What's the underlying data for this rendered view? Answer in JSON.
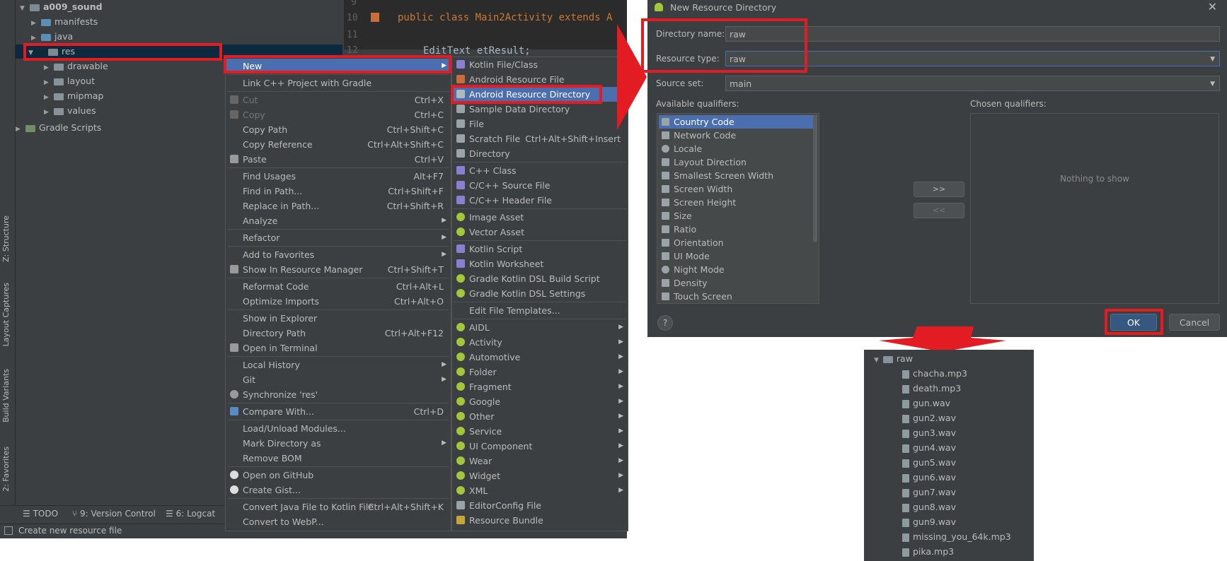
{
  "tree": {
    "project": "a009_sound",
    "items": [
      "manifests",
      "java",
      "res",
      "drawable",
      "layout",
      "mipmap",
      "values",
      "Gradle Scripts"
    ]
  },
  "editor": {
    "lines": [
      {
        "num": "9",
        "code": ""
      },
      {
        "num": "10",
        "code": "public class Main2Activity extends A"
      },
      {
        "num": "11",
        "code": ""
      },
      {
        "num": "12",
        "code": "EditText etResult;"
      }
    ]
  },
  "side_tabs": [
    "Z: Structure",
    "Layout Captures",
    "Build Variants",
    "2: Favorites"
  ],
  "bottom_tabs": [
    "TODO",
    "9: Version Control",
    "6: Logcat"
  ],
  "status_text": "Create new resource file",
  "context_menu": [
    {
      "label": "New",
      "shortcut": "",
      "submenu": true,
      "selected": true
    },
    {
      "label": "Link C++ Project with Gradle",
      "shortcut": ""
    },
    {
      "label": "Cut",
      "shortcut": "Ctrl+X",
      "disabled": true
    },
    {
      "label": "Copy",
      "shortcut": "Ctrl+C",
      "disabled": true
    },
    {
      "label": "Copy Path",
      "shortcut": "Ctrl+Shift+C"
    },
    {
      "label": "Copy Reference",
      "shortcut": "Ctrl+Alt+Shift+C"
    },
    {
      "label": "Paste",
      "shortcut": "Ctrl+V"
    },
    {
      "label": "Find Usages",
      "shortcut": "Alt+F7"
    },
    {
      "label": "Find in Path...",
      "shortcut": "Ctrl+Shift+F"
    },
    {
      "label": "Replace in Path...",
      "shortcut": "Ctrl+Shift+R"
    },
    {
      "label": "Analyze",
      "shortcut": "",
      "submenu": true
    },
    {
      "label": "Refactor",
      "shortcut": "",
      "submenu": true
    },
    {
      "label": "Add to Favorites",
      "shortcut": "",
      "submenu": true
    },
    {
      "label": "Show In Resource Manager",
      "shortcut": "Ctrl+Shift+T"
    },
    {
      "label": "Reformat Code",
      "shortcut": "Ctrl+Alt+L"
    },
    {
      "label": "Optimize Imports",
      "shortcut": "Ctrl+Alt+O"
    },
    {
      "label": "Show in Explorer",
      "shortcut": ""
    },
    {
      "label": "Directory Path",
      "shortcut": "Ctrl+Alt+F12"
    },
    {
      "label": "Open in Terminal",
      "shortcut": ""
    },
    {
      "label": "Local History",
      "shortcut": "",
      "submenu": true
    },
    {
      "label": "Git",
      "shortcut": "",
      "submenu": true
    },
    {
      "label": "Synchronize 'res'",
      "shortcut": ""
    },
    {
      "label": "Compare With...",
      "shortcut": "Ctrl+D"
    },
    {
      "label": "Load/Unload Modules...",
      "shortcut": ""
    },
    {
      "label": "Mark Directory as",
      "shortcut": "",
      "submenu": true
    },
    {
      "label": "Remove BOM",
      "shortcut": ""
    },
    {
      "label": "Open on GitHub",
      "shortcut": ""
    },
    {
      "label": "Create Gist...",
      "shortcut": ""
    },
    {
      "label": "Convert Java File to Kotlin File",
      "shortcut": "Ctrl+Alt+Shift+K"
    },
    {
      "label": "Convert to WebP...",
      "shortcut": ""
    }
  ],
  "new_submenu": [
    {
      "label": "Kotlin File/Class",
      "shortcut": ""
    },
    {
      "label": "Android Resource File",
      "shortcut": ""
    },
    {
      "label": "Android Resource Directory",
      "shortcut": "",
      "selected": true
    },
    {
      "label": "Sample Data Directory",
      "shortcut": ""
    },
    {
      "label": "File",
      "shortcut": ""
    },
    {
      "label": "Scratch File",
      "shortcut": "Ctrl+Alt+Shift+Insert"
    },
    {
      "label": "Directory",
      "shortcut": ""
    },
    {
      "label": "C++ Class",
      "shortcut": ""
    },
    {
      "label": "C/C++ Source File",
      "shortcut": ""
    },
    {
      "label": "C/C++ Header File",
      "shortcut": ""
    },
    {
      "label": "Image Asset",
      "shortcut": ""
    },
    {
      "label": "Vector Asset",
      "shortcut": ""
    },
    {
      "label": "Kotlin Script",
      "shortcut": ""
    },
    {
      "label": "Kotlin Worksheet",
      "shortcut": ""
    },
    {
      "label": "Gradle Kotlin DSL Build Script",
      "shortcut": ""
    },
    {
      "label": "Gradle Kotlin DSL Settings",
      "shortcut": ""
    },
    {
      "label": "Edit File Templates...",
      "shortcut": ""
    },
    {
      "label": "AIDL",
      "shortcut": "",
      "submenu": true
    },
    {
      "label": "Activity",
      "shortcut": "",
      "submenu": true
    },
    {
      "label": "Automotive",
      "shortcut": "",
      "submenu": true
    },
    {
      "label": "Folder",
      "shortcut": "",
      "submenu": true
    },
    {
      "label": "Fragment",
      "shortcut": "",
      "submenu": true
    },
    {
      "label": "Google",
      "shortcut": "",
      "submenu": true
    },
    {
      "label": "Other",
      "shortcut": "",
      "submenu": true
    },
    {
      "label": "Service",
      "shortcut": "",
      "submenu": true
    },
    {
      "label": "UI Component",
      "shortcut": "",
      "submenu": true
    },
    {
      "label": "Wear",
      "shortcut": "",
      "submenu": true
    },
    {
      "label": "Widget",
      "shortcut": "",
      "submenu": true
    },
    {
      "label": "XML",
      "shortcut": "",
      "submenu": true
    },
    {
      "label": "EditorConfig File",
      "shortcut": ""
    },
    {
      "label": "Resource Bundle",
      "shortcut": ""
    }
  ],
  "dialog": {
    "title": "New Resource Directory",
    "directory_name_label": "Directory name:",
    "directory_name_value": "raw",
    "resource_type_label": "Resource type:",
    "resource_type_value": "raw",
    "source_set_label": "Source set:",
    "source_set_value": "main",
    "available_label": "Available qualifiers:",
    "chosen_label": "Chosen qualifiers:",
    "qualifiers": [
      "Country Code",
      "Network Code",
      "Locale",
      "Layout Direction",
      "Smallest Screen Width",
      "Screen Width",
      "Screen Height",
      "Size",
      "Ratio",
      "Orientation",
      "UI Mode",
      "Night Mode",
      "Density",
      "Touch Screen"
    ],
    "add_button": ">>",
    "remove_button": "<<",
    "empty_text": "Nothing to show",
    "help_button": "?",
    "ok_button": "OK",
    "cancel_button": "Cancel"
  },
  "raw_folder": {
    "name": "raw",
    "files": [
      "chacha.mp3",
      "death.mp3",
      "gun.wav",
      "gun2.wav",
      "gun3.wav",
      "gun4.wav",
      "gun5.wav",
      "gun6.wav",
      "gun7.wav",
      "gun8.wav",
      "gun9.wav",
      "missing_you_64k.mp3",
      "pika.mp3"
    ]
  },
  "colors": {
    "accent_red": "#e31b23",
    "selection": "#4b6eaf",
    "bg": "#3c3f41"
  }
}
